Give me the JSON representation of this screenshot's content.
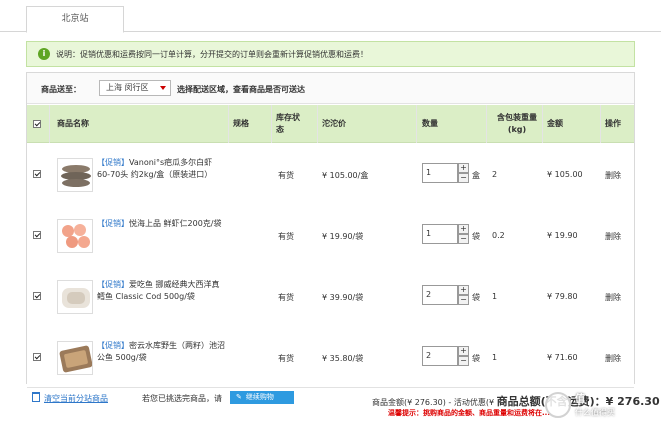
{
  "tab": {
    "label": "北京站"
  },
  "notice": {
    "text": "说明：促销优惠和运费按同一订单计算，分开提交的订单则会重新计算促销优惠和运费！"
  },
  "shipping": {
    "label": "商品送至：",
    "region": "上海 闵行区",
    "hint": "选择配送区域，查看商品是否可送达"
  },
  "columns": {
    "name": "商品名称",
    "spec": "规格",
    "stock": "库存状态",
    "price": "沱沱价",
    "qty": "数量",
    "weight": "含包装重量(kg)",
    "amount": "金额",
    "action": "操作"
  },
  "rows": [
    {
      "promo": "【促销】",
      "name": "Vanoni°s疤瓜多尔白虾60-70头 约2kg/盒（原装进口）",
      "stock": "有货",
      "price": "¥ 105.00/盒",
      "qty": "1",
      "unit": "盒",
      "weight": "2",
      "amount": "¥ 105.00",
      "action": "删除"
    },
    {
      "promo": "【促销】",
      "name": "悦海上品 鲜虾仁200克/袋",
      "stock": "有货",
      "price": "¥ 19.90/袋",
      "qty": "1",
      "unit": "袋",
      "weight": "0.2",
      "amount": "¥ 19.90",
      "action": "删除"
    },
    {
      "promo": "【促销】",
      "name": "爱吃鱼 挪威经典大西洋真鳕鱼 Classic Cod 500g/袋",
      "stock": "有货",
      "price": "¥ 39.90/袋",
      "qty": "2",
      "unit": "袋",
      "weight": "1",
      "amount": "¥ 79.80",
      "action": "删除"
    },
    {
      "promo": "【促销】",
      "name": "密云水库野生（两籽）池沼公鱼 500g/袋",
      "stock": "有货",
      "price": "¥ 35.80/袋",
      "qty": "2",
      "unit": "袋",
      "weight": "1",
      "amount": "¥ 71.60",
      "action": "删除"
    }
  ],
  "footer": {
    "clear_link": "清空当前分站商品",
    "after_text": "若您已挑选完商品，请",
    "continue_button": "继续购物",
    "summary_prefix": "商品金额(¥ 276.30) - 活动优惠(¥",
    "summary_total": "商品总额(不含运费)：¥ 276.30",
    "tip": "温馨提示：挑购商品的金额、商品重量和运费将在..."
  },
  "watermark": {
    "zhi": "值",
    "en": "什么值得买"
  },
  "colors": {
    "header_bg": "#dbeec6",
    "notice_bg": "#e9f7d9",
    "link": "#2e77c9",
    "button": "#2e9ae0",
    "warning": "#dd0000"
  }
}
